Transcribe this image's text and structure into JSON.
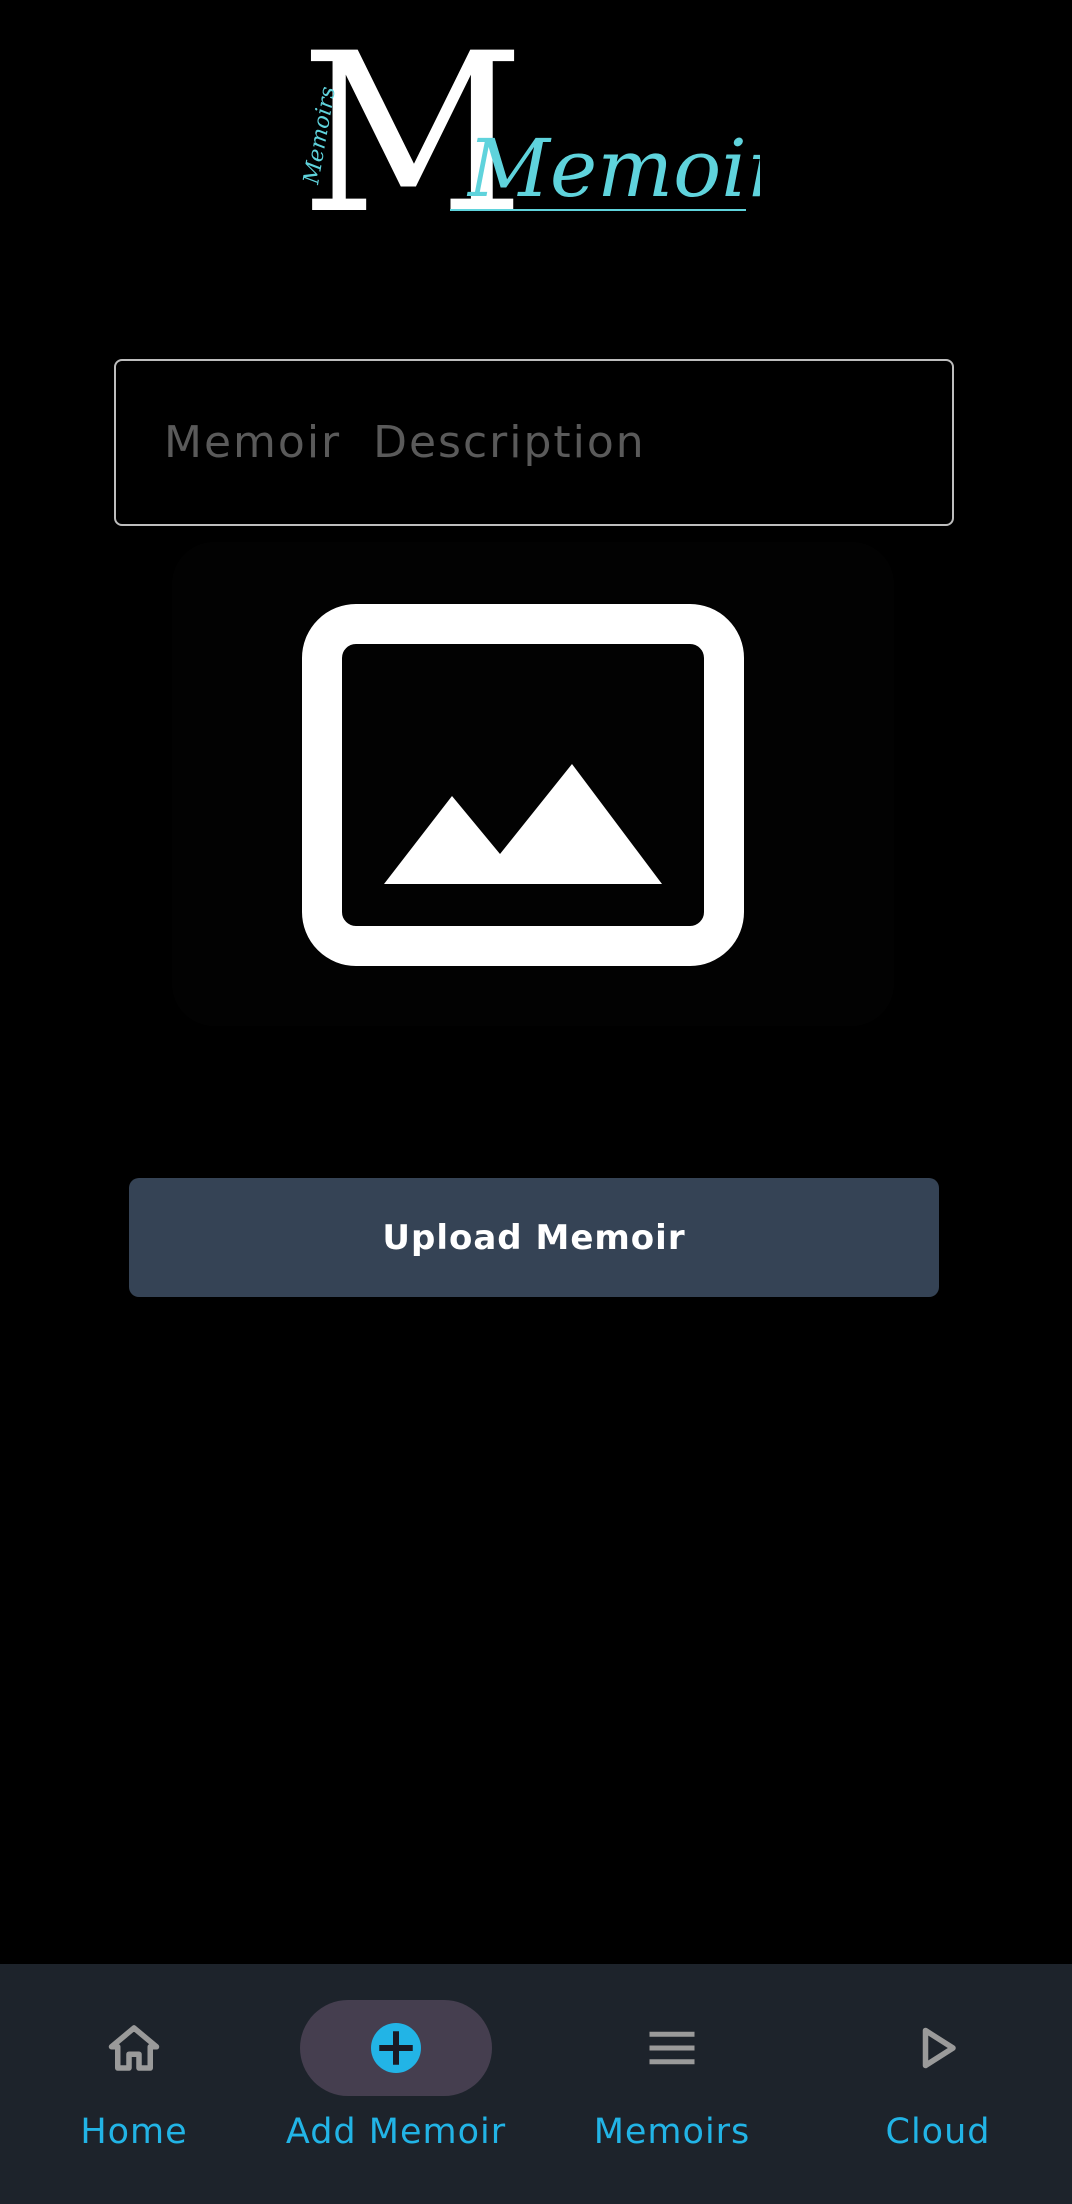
{
  "app": {
    "logo_text": "Memoirs",
    "logo_small_text": "Memoirs"
  },
  "form": {
    "description_placeholder": "Memoir  Description",
    "description_value": "",
    "image_picker_icon": "image-placeholder-icon",
    "upload_label": "Upload Memoir"
  },
  "nav": {
    "items": [
      {
        "label": "Home",
        "icon": "home-icon",
        "active": false
      },
      {
        "label": "Add Memoir",
        "icon": "add-circle-icon",
        "active": true
      },
      {
        "label": "Memoirs",
        "icon": "menu-icon",
        "active": false
      },
      {
        "label": "Cloud",
        "icon": "play-icon",
        "active": false
      }
    ]
  },
  "colors": {
    "background": "#000000",
    "accent": "#22b4e6",
    "logo_teal": "#5fd3dc",
    "button": "#354355",
    "nav_background": "#1d232b",
    "nav_active_pill": "#453e4f"
  }
}
